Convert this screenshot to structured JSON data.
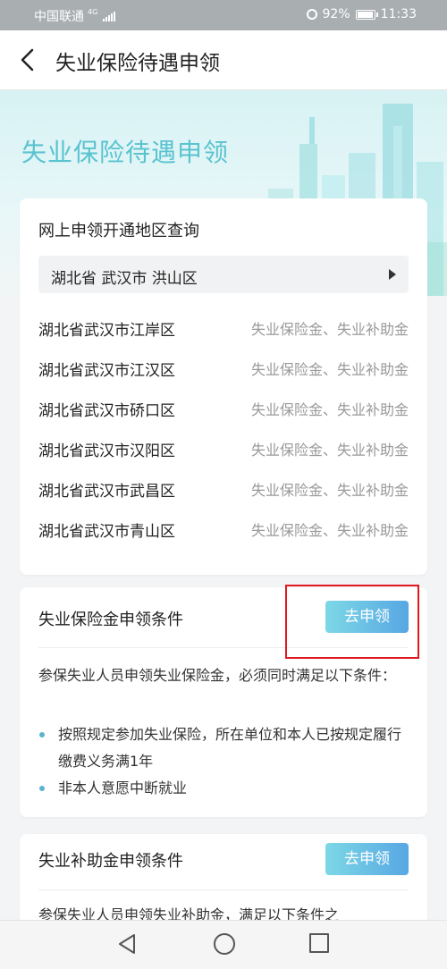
{
  "status_bar": {
    "carrier": "中国联通",
    "network": "4G",
    "battery": "92%",
    "time": "11:33"
  },
  "nav": {
    "title": "失业保险待遇申领"
  },
  "hero": {
    "title": "失业保险待遇申领"
  },
  "region_card": {
    "title": "网上申领开通地区查询",
    "selected_region": "湖北省 武汉市 洪山区",
    "rows": [
      {
        "name": "湖北省武汉市江岸区",
        "services": "失业保险金、失业补助金"
      },
      {
        "name": "湖北省武汉市江汉区",
        "services": "失业保险金、失业补助金"
      },
      {
        "name": "湖北省武汉市硚口区",
        "services": "失业保险金、失业补助金"
      },
      {
        "name": "湖北省武汉市汉阳区",
        "services": "失业保险金、失业补助金"
      },
      {
        "name": "湖北省武汉市武昌区",
        "services": "失业保险金、失业补助金"
      },
      {
        "name": "湖北省武汉市青山区",
        "services": "失业保险金、失业补助金"
      }
    ]
  },
  "insurance_card": {
    "title": "失业保险金申领条件",
    "apply_label": "去申领",
    "description": "参保失业人员申领失业保险金，必须同时满足以下条件：",
    "conditions": [
      "按照规定参加失业保险，所在单位和本人已按规定履行缴费义务满1年",
      "非本人意愿中断就业"
    ]
  },
  "subsidy_card": {
    "title": "失业补助金申领条件",
    "apply_label": "去申领",
    "description": "参保失业人员申领失业补助金，满足以下条件之"
  },
  "colors": {
    "accent": "#59c3cf",
    "button": "#57a7e3",
    "highlight": "#e0181f"
  },
  "icons": [
    "back-arrow-icon",
    "dropdown-caret-icon",
    "nav-back-triangle-icon",
    "nav-home-circle-icon",
    "nav-recent-square-icon"
  ]
}
